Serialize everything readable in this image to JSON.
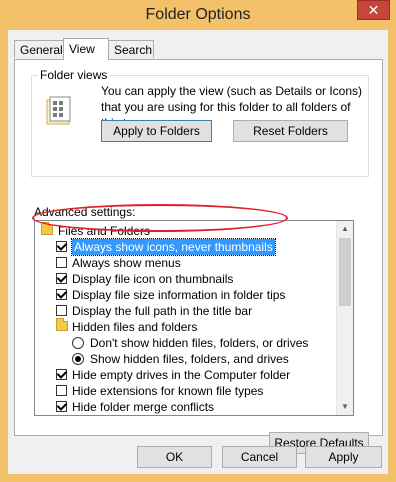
{
  "window": {
    "title": "Folder Options",
    "close_glyph": "✕",
    "colors": {
      "frame": "#f3c16a",
      "close": "#c7463a",
      "selection": "#3399ff",
      "annotation": "#e0202a"
    }
  },
  "tabs": [
    {
      "label": "General",
      "active": false
    },
    {
      "label": "View",
      "active": true
    },
    {
      "label": "Search",
      "active": false
    }
  ],
  "folder_views": {
    "legend": "Folder views",
    "icon": "folder-views-icon",
    "description": "You can apply the view (such as Details or Icons) that you are using for this folder to all folders of this type.",
    "apply_button": "Apply to Folders",
    "reset_button": "Reset Folders"
  },
  "advanced": {
    "label": "Advanced settings:",
    "items": [
      {
        "type": "folder",
        "label": "Files and Folders",
        "indent": 0
      },
      {
        "type": "checkbox",
        "label": "Always show icons, never thumbnails",
        "checked": true,
        "selected": true,
        "indent": 1
      },
      {
        "type": "checkbox",
        "label": "Always show menus",
        "checked": false,
        "indent": 1
      },
      {
        "type": "checkbox",
        "label": "Display file icon on thumbnails",
        "checked": true,
        "indent": 1
      },
      {
        "type": "checkbox",
        "label": "Display file size information in folder tips",
        "checked": true,
        "indent": 1
      },
      {
        "type": "checkbox",
        "label": "Display the full path in the title bar",
        "checked": false,
        "indent": 1
      },
      {
        "type": "folder",
        "label": "Hidden files and folders",
        "indent": 1
      },
      {
        "type": "radio",
        "label": "Don't show hidden files, folders, or drives",
        "checked": false,
        "indent": 2
      },
      {
        "type": "radio",
        "label": "Show hidden files, folders, and drives",
        "checked": true,
        "indent": 2
      },
      {
        "type": "checkbox",
        "label": "Hide empty drives in the Computer folder",
        "checked": true,
        "indent": 1
      },
      {
        "type": "checkbox",
        "label": "Hide extensions for known file types",
        "checked": false,
        "indent": 1
      },
      {
        "type": "checkbox",
        "label": "Hide folder merge conflicts",
        "checked": true,
        "indent": 1
      }
    ]
  },
  "buttons": {
    "restore_defaults": "Restore Defaults",
    "ok": "OK",
    "cancel": "Cancel",
    "apply": "Apply"
  }
}
